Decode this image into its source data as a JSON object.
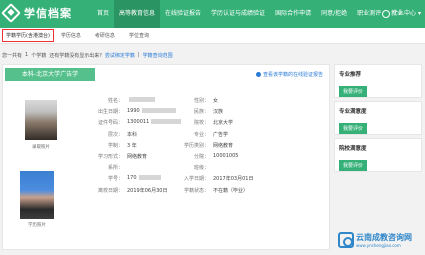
{
  "header": {
    "logo_text": "学信档案",
    "nav": [
      "首页",
      "高等教育信息",
      "在线验证报告",
      "学历认证与成绩验证",
      "国际合作申请",
      "同意/拒绝",
      "职业测评",
      "就业"
    ],
    "user": "个人中心"
  },
  "subnav": [
    "学籍学历(含港澳台)",
    "学历信息",
    "考研信息",
    "学位查询"
  ],
  "notice": {
    "parts": [
      "您一共有",
      "1",
      "个学籍",
      "还有学籍没有显示出来?",
      "尝试绑定学籍",
      "学籍查询范围"
    ]
  },
  "record": {
    "school_pill": "本科-北京大学广告学",
    "verify_link": "查看该学籍的在线验证报告",
    "photo1_caption": "录取照片",
    "photo2_caption": "学历照片",
    "rows": [
      {
        "label": "姓名：",
        "value": "",
        "label2": "性别：",
        "value2": "女"
      },
      {
        "label": "出生日期：",
        "value": "1990",
        "label2": "民族：",
        "value2": "汉族"
      },
      {
        "label": "证件号码：",
        "value": "1300011",
        "label2": "院校：",
        "value2": "北京大学"
      },
      {
        "label": "层次：",
        "value": "本科",
        "label2": "专业：",
        "value2": "广告学"
      },
      {
        "label": "学制：",
        "value": "3 年",
        "label2": "学历类别：",
        "value2": "网络教育"
      },
      {
        "label": "学习形式：",
        "value": "网络教育",
        "label2": "分院：",
        "value2": "10001005"
      },
      {
        "label": "系所：",
        "value": "",
        "label2": "班级：",
        "value2": ""
      },
      {
        "label": "学号：",
        "value": "170",
        "label2": "入学日期：",
        "value2": "2017年03月01日"
      },
      {
        "label": "离校日期：",
        "value": "2019年06月30日",
        "label2": "学籍状态：",
        "value2": "不在籍（毕业）"
      }
    ]
  },
  "sidebar": {
    "sections": [
      {
        "title": "专业推荐",
        "button": "我要评价"
      },
      {
        "title": "专业满意度",
        "button": "我要评价"
      },
      {
        "title": "院校满意度",
        "button": "我要评价"
      }
    ]
  },
  "watermark": {
    "title": "云南成教咨询网",
    "url": "www.ynchengjiao.com"
  }
}
